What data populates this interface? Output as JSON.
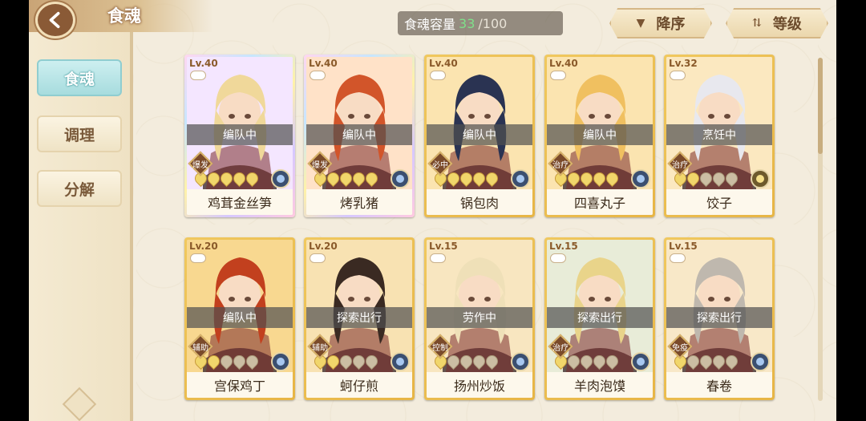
{
  "header": {
    "title": "食魂"
  },
  "capacity": {
    "label": "食魂容量",
    "current": "33",
    "max": "/100"
  },
  "sort": {
    "order_label": "降序",
    "field_label": "等级"
  },
  "sidebar": {
    "items": [
      {
        "label": "食魂",
        "active": true
      },
      {
        "label": "调理",
        "active": false
      },
      {
        "label": "分解",
        "active": false
      }
    ]
  },
  "cards": [
    {
      "level": "Lv.40",
      "status": "编队中",
      "role": "爆发",
      "name": "鸡茸金丝笋",
      "frame": "rainbow",
      "stars": 5,
      "hair": "#f0d89a",
      "bg": "#f4e6ff"
    },
    {
      "level": "Lv.40",
      "status": "编队中",
      "role": "爆发",
      "name": "烤乳猪",
      "frame": "rainbow",
      "stars": 5,
      "hair": "#d2552a",
      "bg": "#ffe2c8"
    },
    {
      "level": "Lv.40",
      "status": "编队中",
      "role": "必中",
      "name": "锅包肉",
      "frame": "gold",
      "stars": 5,
      "hair": "#2a3352",
      "bg": "#fbe4b0"
    },
    {
      "level": "Lv.40",
      "status": "编队中",
      "role": "治疗",
      "name": "四喜丸子",
      "frame": "gold",
      "stars": 5,
      "hair": "#f0c060",
      "bg": "#fbe4b0"
    },
    {
      "level": "Lv.32",
      "status": "烹饪中",
      "role": "治疗",
      "name": "饺子",
      "frame": "gold",
      "stars": 2,
      "hair": "#e8e8ee",
      "bg": "#fbe8c0"
    },
    {
      "level": "Lv.20",
      "status": "编队中",
      "role": "辅助",
      "name": "宫保鸡丁",
      "frame": "gold",
      "stars": 2,
      "hair": "#c2401e",
      "bg": "#f8d890"
    },
    {
      "level": "Lv.20",
      "status": "探索出行",
      "role": "辅助",
      "name": "蚵仔煎",
      "frame": "gold",
      "stars": 2,
      "hair": "#3a2a22",
      "bg": "#f8e2b2"
    },
    {
      "level": "Lv.15",
      "status": "劳作中",
      "role": "控制",
      "name": "扬州炒饭",
      "frame": "gold",
      "stars": 1,
      "hair": "#efe0b8",
      "bg": "#f8e6c0"
    },
    {
      "level": "Lv.15",
      "status": "探索出行",
      "role": "治疗",
      "name": "羊肉泡馍",
      "frame": "gold",
      "stars": 1,
      "hair": "#e9d48a",
      "bg": "#e8ecd8"
    },
    {
      "level": "Lv.15",
      "status": "探索出行",
      "role": "免疫",
      "name": "春卷",
      "frame": "gold",
      "stars": 1,
      "hair": "#bfb8ae",
      "bg": "#f8e8c8"
    }
  ]
}
